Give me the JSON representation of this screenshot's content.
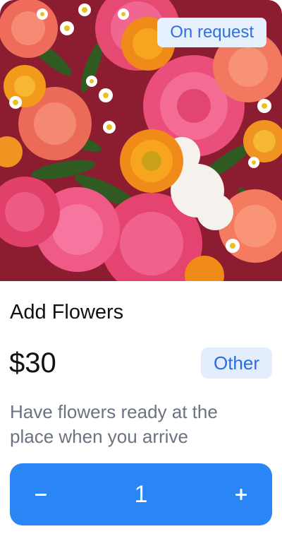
{
  "product": {
    "badge": "On request",
    "title": "Add Flowers",
    "price": "$30",
    "category": "Other",
    "description": "Have flowers ready at the place when you arrive"
  },
  "stepper": {
    "decrement_label": "–",
    "quantity": "1",
    "increment_label": "+"
  },
  "colors": {
    "accent": "#2a86f4",
    "badge_bg": "#e7f0fd",
    "badge_text": "#2f6fe1",
    "muted_text": "#6b7380"
  },
  "icons": {
    "decrement": "minus-icon",
    "increment": "plus-icon"
  }
}
